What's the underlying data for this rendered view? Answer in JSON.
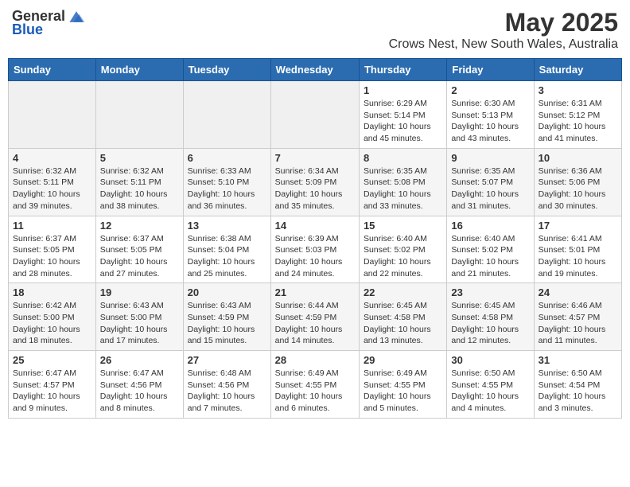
{
  "header": {
    "logo_general": "General",
    "logo_blue": "Blue",
    "title": "May 2025",
    "subtitle": "Crows Nest, New South Wales, Australia"
  },
  "weekdays": [
    "Sunday",
    "Monday",
    "Tuesday",
    "Wednesday",
    "Thursday",
    "Friday",
    "Saturday"
  ],
  "weeks": [
    [
      {
        "day": "",
        "info": ""
      },
      {
        "day": "",
        "info": ""
      },
      {
        "day": "",
        "info": ""
      },
      {
        "day": "",
        "info": ""
      },
      {
        "day": "1",
        "info": "Sunrise: 6:29 AM\nSunset: 5:14 PM\nDaylight: 10 hours\nand 45 minutes."
      },
      {
        "day": "2",
        "info": "Sunrise: 6:30 AM\nSunset: 5:13 PM\nDaylight: 10 hours\nand 43 minutes."
      },
      {
        "day": "3",
        "info": "Sunrise: 6:31 AM\nSunset: 5:12 PM\nDaylight: 10 hours\nand 41 minutes."
      }
    ],
    [
      {
        "day": "4",
        "info": "Sunrise: 6:32 AM\nSunset: 5:11 PM\nDaylight: 10 hours\nand 39 minutes."
      },
      {
        "day": "5",
        "info": "Sunrise: 6:32 AM\nSunset: 5:11 PM\nDaylight: 10 hours\nand 38 minutes."
      },
      {
        "day": "6",
        "info": "Sunrise: 6:33 AM\nSunset: 5:10 PM\nDaylight: 10 hours\nand 36 minutes."
      },
      {
        "day": "7",
        "info": "Sunrise: 6:34 AM\nSunset: 5:09 PM\nDaylight: 10 hours\nand 35 minutes."
      },
      {
        "day": "8",
        "info": "Sunrise: 6:35 AM\nSunset: 5:08 PM\nDaylight: 10 hours\nand 33 minutes."
      },
      {
        "day": "9",
        "info": "Sunrise: 6:35 AM\nSunset: 5:07 PM\nDaylight: 10 hours\nand 31 minutes."
      },
      {
        "day": "10",
        "info": "Sunrise: 6:36 AM\nSunset: 5:06 PM\nDaylight: 10 hours\nand 30 minutes."
      }
    ],
    [
      {
        "day": "11",
        "info": "Sunrise: 6:37 AM\nSunset: 5:05 PM\nDaylight: 10 hours\nand 28 minutes."
      },
      {
        "day": "12",
        "info": "Sunrise: 6:37 AM\nSunset: 5:05 PM\nDaylight: 10 hours\nand 27 minutes."
      },
      {
        "day": "13",
        "info": "Sunrise: 6:38 AM\nSunset: 5:04 PM\nDaylight: 10 hours\nand 25 minutes."
      },
      {
        "day": "14",
        "info": "Sunrise: 6:39 AM\nSunset: 5:03 PM\nDaylight: 10 hours\nand 24 minutes."
      },
      {
        "day": "15",
        "info": "Sunrise: 6:40 AM\nSunset: 5:02 PM\nDaylight: 10 hours\nand 22 minutes."
      },
      {
        "day": "16",
        "info": "Sunrise: 6:40 AM\nSunset: 5:02 PM\nDaylight: 10 hours\nand 21 minutes."
      },
      {
        "day": "17",
        "info": "Sunrise: 6:41 AM\nSunset: 5:01 PM\nDaylight: 10 hours\nand 19 minutes."
      }
    ],
    [
      {
        "day": "18",
        "info": "Sunrise: 6:42 AM\nSunset: 5:00 PM\nDaylight: 10 hours\nand 18 minutes."
      },
      {
        "day": "19",
        "info": "Sunrise: 6:43 AM\nSunset: 5:00 PM\nDaylight: 10 hours\nand 17 minutes."
      },
      {
        "day": "20",
        "info": "Sunrise: 6:43 AM\nSunset: 4:59 PM\nDaylight: 10 hours\nand 15 minutes."
      },
      {
        "day": "21",
        "info": "Sunrise: 6:44 AM\nSunset: 4:59 PM\nDaylight: 10 hours\nand 14 minutes."
      },
      {
        "day": "22",
        "info": "Sunrise: 6:45 AM\nSunset: 4:58 PM\nDaylight: 10 hours\nand 13 minutes."
      },
      {
        "day": "23",
        "info": "Sunrise: 6:45 AM\nSunset: 4:58 PM\nDaylight: 10 hours\nand 12 minutes."
      },
      {
        "day": "24",
        "info": "Sunrise: 6:46 AM\nSunset: 4:57 PM\nDaylight: 10 hours\nand 11 minutes."
      }
    ],
    [
      {
        "day": "25",
        "info": "Sunrise: 6:47 AM\nSunset: 4:57 PM\nDaylight: 10 hours\nand 9 minutes."
      },
      {
        "day": "26",
        "info": "Sunrise: 6:47 AM\nSunset: 4:56 PM\nDaylight: 10 hours\nand 8 minutes."
      },
      {
        "day": "27",
        "info": "Sunrise: 6:48 AM\nSunset: 4:56 PM\nDaylight: 10 hours\nand 7 minutes."
      },
      {
        "day": "28",
        "info": "Sunrise: 6:49 AM\nSunset: 4:55 PM\nDaylight: 10 hours\nand 6 minutes."
      },
      {
        "day": "29",
        "info": "Sunrise: 6:49 AM\nSunset: 4:55 PM\nDaylight: 10 hours\nand 5 minutes."
      },
      {
        "day": "30",
        "info": "Sunrise: 6:50 AM\nSunset: 4:55 PM\nDaylight: 10 hours\nand 4 minutes."
      },
      {
        "day": "31",
        "info": "Sunrise: 6:50 AM\nSunset: 4:54 PM\nDaylight: 10 hours\nand 3 minutes."
      }
    ]
  ]
}
